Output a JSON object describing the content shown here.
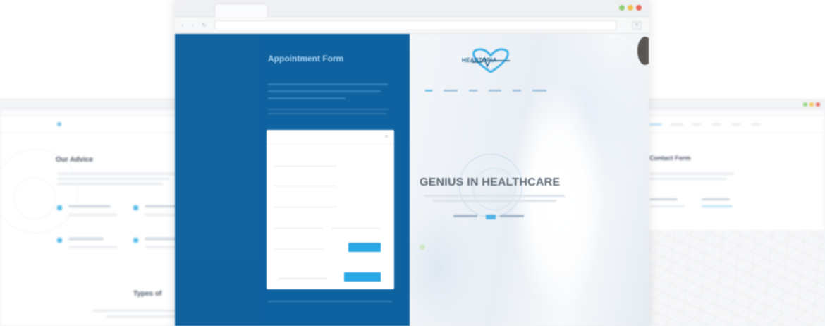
{
  "back_left": {
    "titlebar": "",
    "logo": "",
    "section_title": "Our Advice",
    "bottom_title": "Types of"
  },
  "back_right": {
    "section_title": "Contact Form"
  },
  "front": {
    "tab_title": "",
    "blue_panel": {
      "title": "Appointment Form",
      "intro": "",
      "detail": "",
      "footer": ""
    },
    "form": {
      "header": "",
      "close_icon": "close-icon",
      "fields": [
        "",
        "",
        "",
        "",
        ""
      ],
      "submit_label": "",
      "send_label": ""
    },
    "hero": {
      "logo_text": "HEARTOPIA",
      "nav": [
        "",
        "",
        "",
        "",
        "",
        ""
      ],
      "heading": "GENIUS IN HEALTHCARE",
      "cta_primary": "",
      "cta_secondary": ""
    }
  },
  "colors": {
    "blue_panel": "#0f62a0",
    "accent": "#29a8e6",
    "heading_grey": "#5e6a75"
  }
}
